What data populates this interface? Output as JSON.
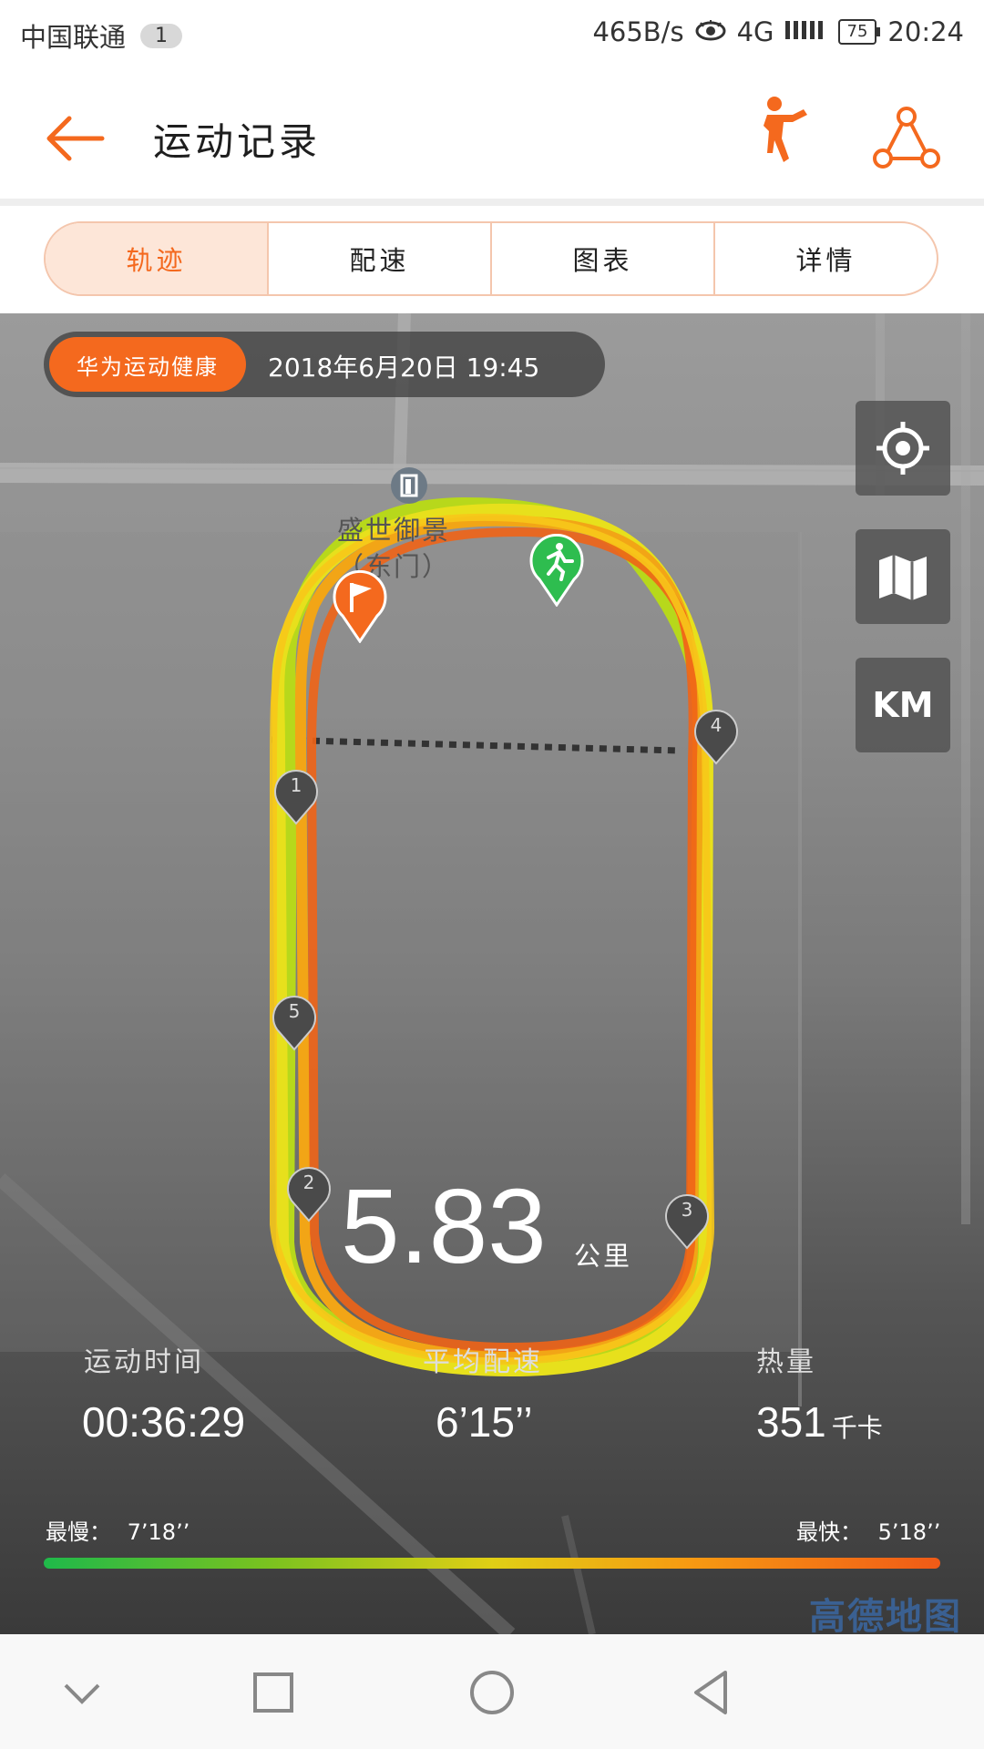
{
  "status_bar": {
    "carrier": "中国联通",
    "sim_badge": "1",
    "net_speed": "465B/s",
    "network": "4G",
    "battery": "75",
    "time": "20:24"
  },
  "header": {
    "title": "运动记录"
  },
  "tabs": [
    {
      "label": "轨迹",
      "active": true
    },
    {
      "label": "配速",
      "active": false
    },
    {
      "label": "图表",
      "active": false
    },
    {
      "label": "详情",
      "active": false
    }
  ],
  "map": {
    "source_tag": "华为运动健康",
    "date": "2018年6月20日 19:45",
    "poi_name": "盛世御景",
    "poi_sub": "（东门）",
    "km_button": "KM",
    "km_markers": [
      "1",
      "2",
      "3",
      "4",
      "5"
    ],
    "provider": "高德地图"
  },
  "summary": {
    "distance": "5.83",
    "distance_unit": "公里"
  },
  "stats": [
    {
      "label": "运动时间",
      "value": "00:36:29",
      "unit": ""
    },
    {
      "label": "平均配速",
      "value": "6’15’’",
      "unit": ""
    },
    {
      "label": "热量",
      "value": "351",
      "unit": "千卡"
    }
  ],
  "pace_legend": {
    "slowest_label": "最慢：",
    "slowest_value": "7’18’’",
    "fastest_label": "最快：",
    "fastest_value": "5’18’’"
  },
  "colors": {
    "accent": "#f4691e",
    "tab_active_bg": "#fde6d8",
    "start_marker": "#2ebd4f",
    "end_marker": "#f4691e"
  }
}
